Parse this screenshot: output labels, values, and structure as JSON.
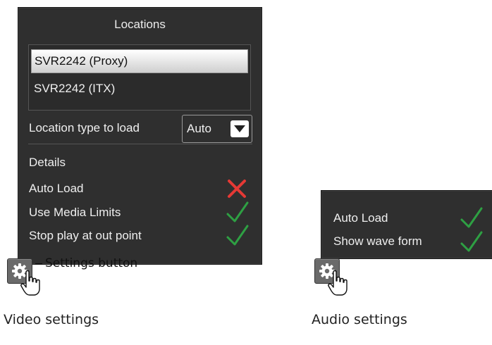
{
  "video_panel": {
    "title": "Locations",
    "locations": [
      "SVR2242 (Proxy)",
      "SVR2242 (ITX)"
    ],
    "selected_index": 0,
    "location_type_label": "Location type to load",
    "location_type_value": "Auto",
    "details_label": "Details",
    "settings": [
      {
        "label": "Auto Load",
        "enabled": false
      },
      {
        "label": "Use Media Limits",
        "enabled": true
      },
      {
        "label": "Stop play at out point",
        "enabled": true
      }
    ]
  },
  "audio_panel": {
    "settings": [
      {
        "label": "Auto Load",
        "enabled": true
      },
      {
        "label": "Show wave form",
        "enabled": true
      }
    ]
  },
  "callout_label": "Settings button",
  "captions": {
    "video": "Video settings",
    "audio": "Audio settings"
  },
  "icons": {
    "gear": "gear-icon",
    "hand": "hand-pointer-icon",
    "check": "check-icon",
    "cross": "cross-icon",
    "dropdown": "chevron-down-icon"
  },
  "colors": {
    "panel_bg": "#2f2f2f",
    "check": "#2ea043",
    "cross": "#e53935",
    "text": "#efefef"
  }
}
